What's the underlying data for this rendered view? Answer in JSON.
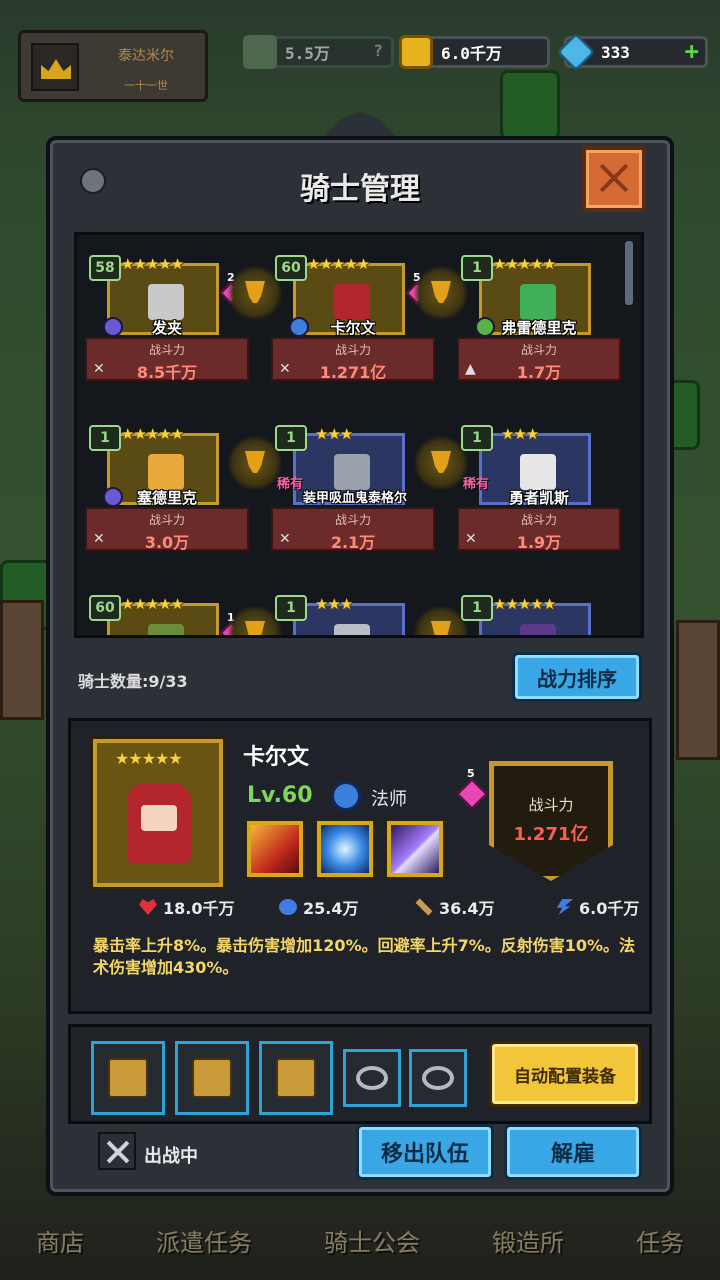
{
  "hud": {
    "player_name": "泰达米尔",
    "player_sub": "一十一世",
    "resource_power": "5.5万",
    "resource_power_q": "?",
    "gold": "6.0千万",
    "gems": "333",
    "plus": "+"
  },
  "dialog": {
    "title": "骑士管理",
    "knight_count": "骑士数量:9/33",
    "sort_label": "战力排序"
  },
  "knights": [
    {
      "level": "58",
      "stars": "★★★★★",
      "name": "发夹",
      "power_label": "战斗力",
      "power": "8.5千万",
      "rank": "2"
    },
    {
      "level": "60",
      "stars": "★★★★★",
      "name": "卡尔文",
      "power_label": "战斗力",
      "power": "1.271亿",
      "rank": "5"
    },
    {
      "level": "1",
      "stars": "★★★★★",
      "name": "弗雷德里克",
      "power_label": "战斗力",
      "power": "1.7万"
    },
    {
      "level": "1",
      "stars": "★★★★★",
      "name": "塞德里克",
      "power_label": "战斗力",
      "power": "3.0万"
    },
    {
      "level": "1",
      "stars": "★★★",
      "name": "装甲吸血鬼泰格尔",
      "rare": "稀有",
      "power_label": "战斗力",
      "power": "2.1万"
    },
    {
      "level": "1",
      "stars": "★★★",
      "name": "勇者凯斯",
      "rare": "稀有",
      "power_label": "战斗力",
      "power": "1.9万"
    },
    {
      "level": "60",
      "stars": "★★★★★",
      "rank": "1"
    },
    {
      "level": "1",
      "stars": "★★★"
    },
    {
      "level": "1",
      "stars": "★★★★★"
    }
  ],
  "detail": {
    "stars": "★★★★★",
    "name": "卡尔文",
    "level": "Lv.60",
    "class": "法师",
    "rank": "5",
    "power_label": "战斗力",
    "power": "1.271亿",
    "hp": "18.0千万",
    "mp": "25.4万",
    "atk": "36.4万",
    "spd": "6.0千万",
    "description": "暴击率上升8%。暴击伤害增加120%。回避率上升7%。反射伤害10%。法术伤害增加430%。"
  },
  "equipment": {
    "auto_label": "自动配置装备"
  },
  "footer": {
    "status": "出战中",
    "remove_label": "移出队伍",
    "fire_label": "解雇"
  },
  "bottom_nav": [
    "商店",
    "派遣任务",
    "骑士公会",
    "锻造所",
    "任务"
  ]
}
